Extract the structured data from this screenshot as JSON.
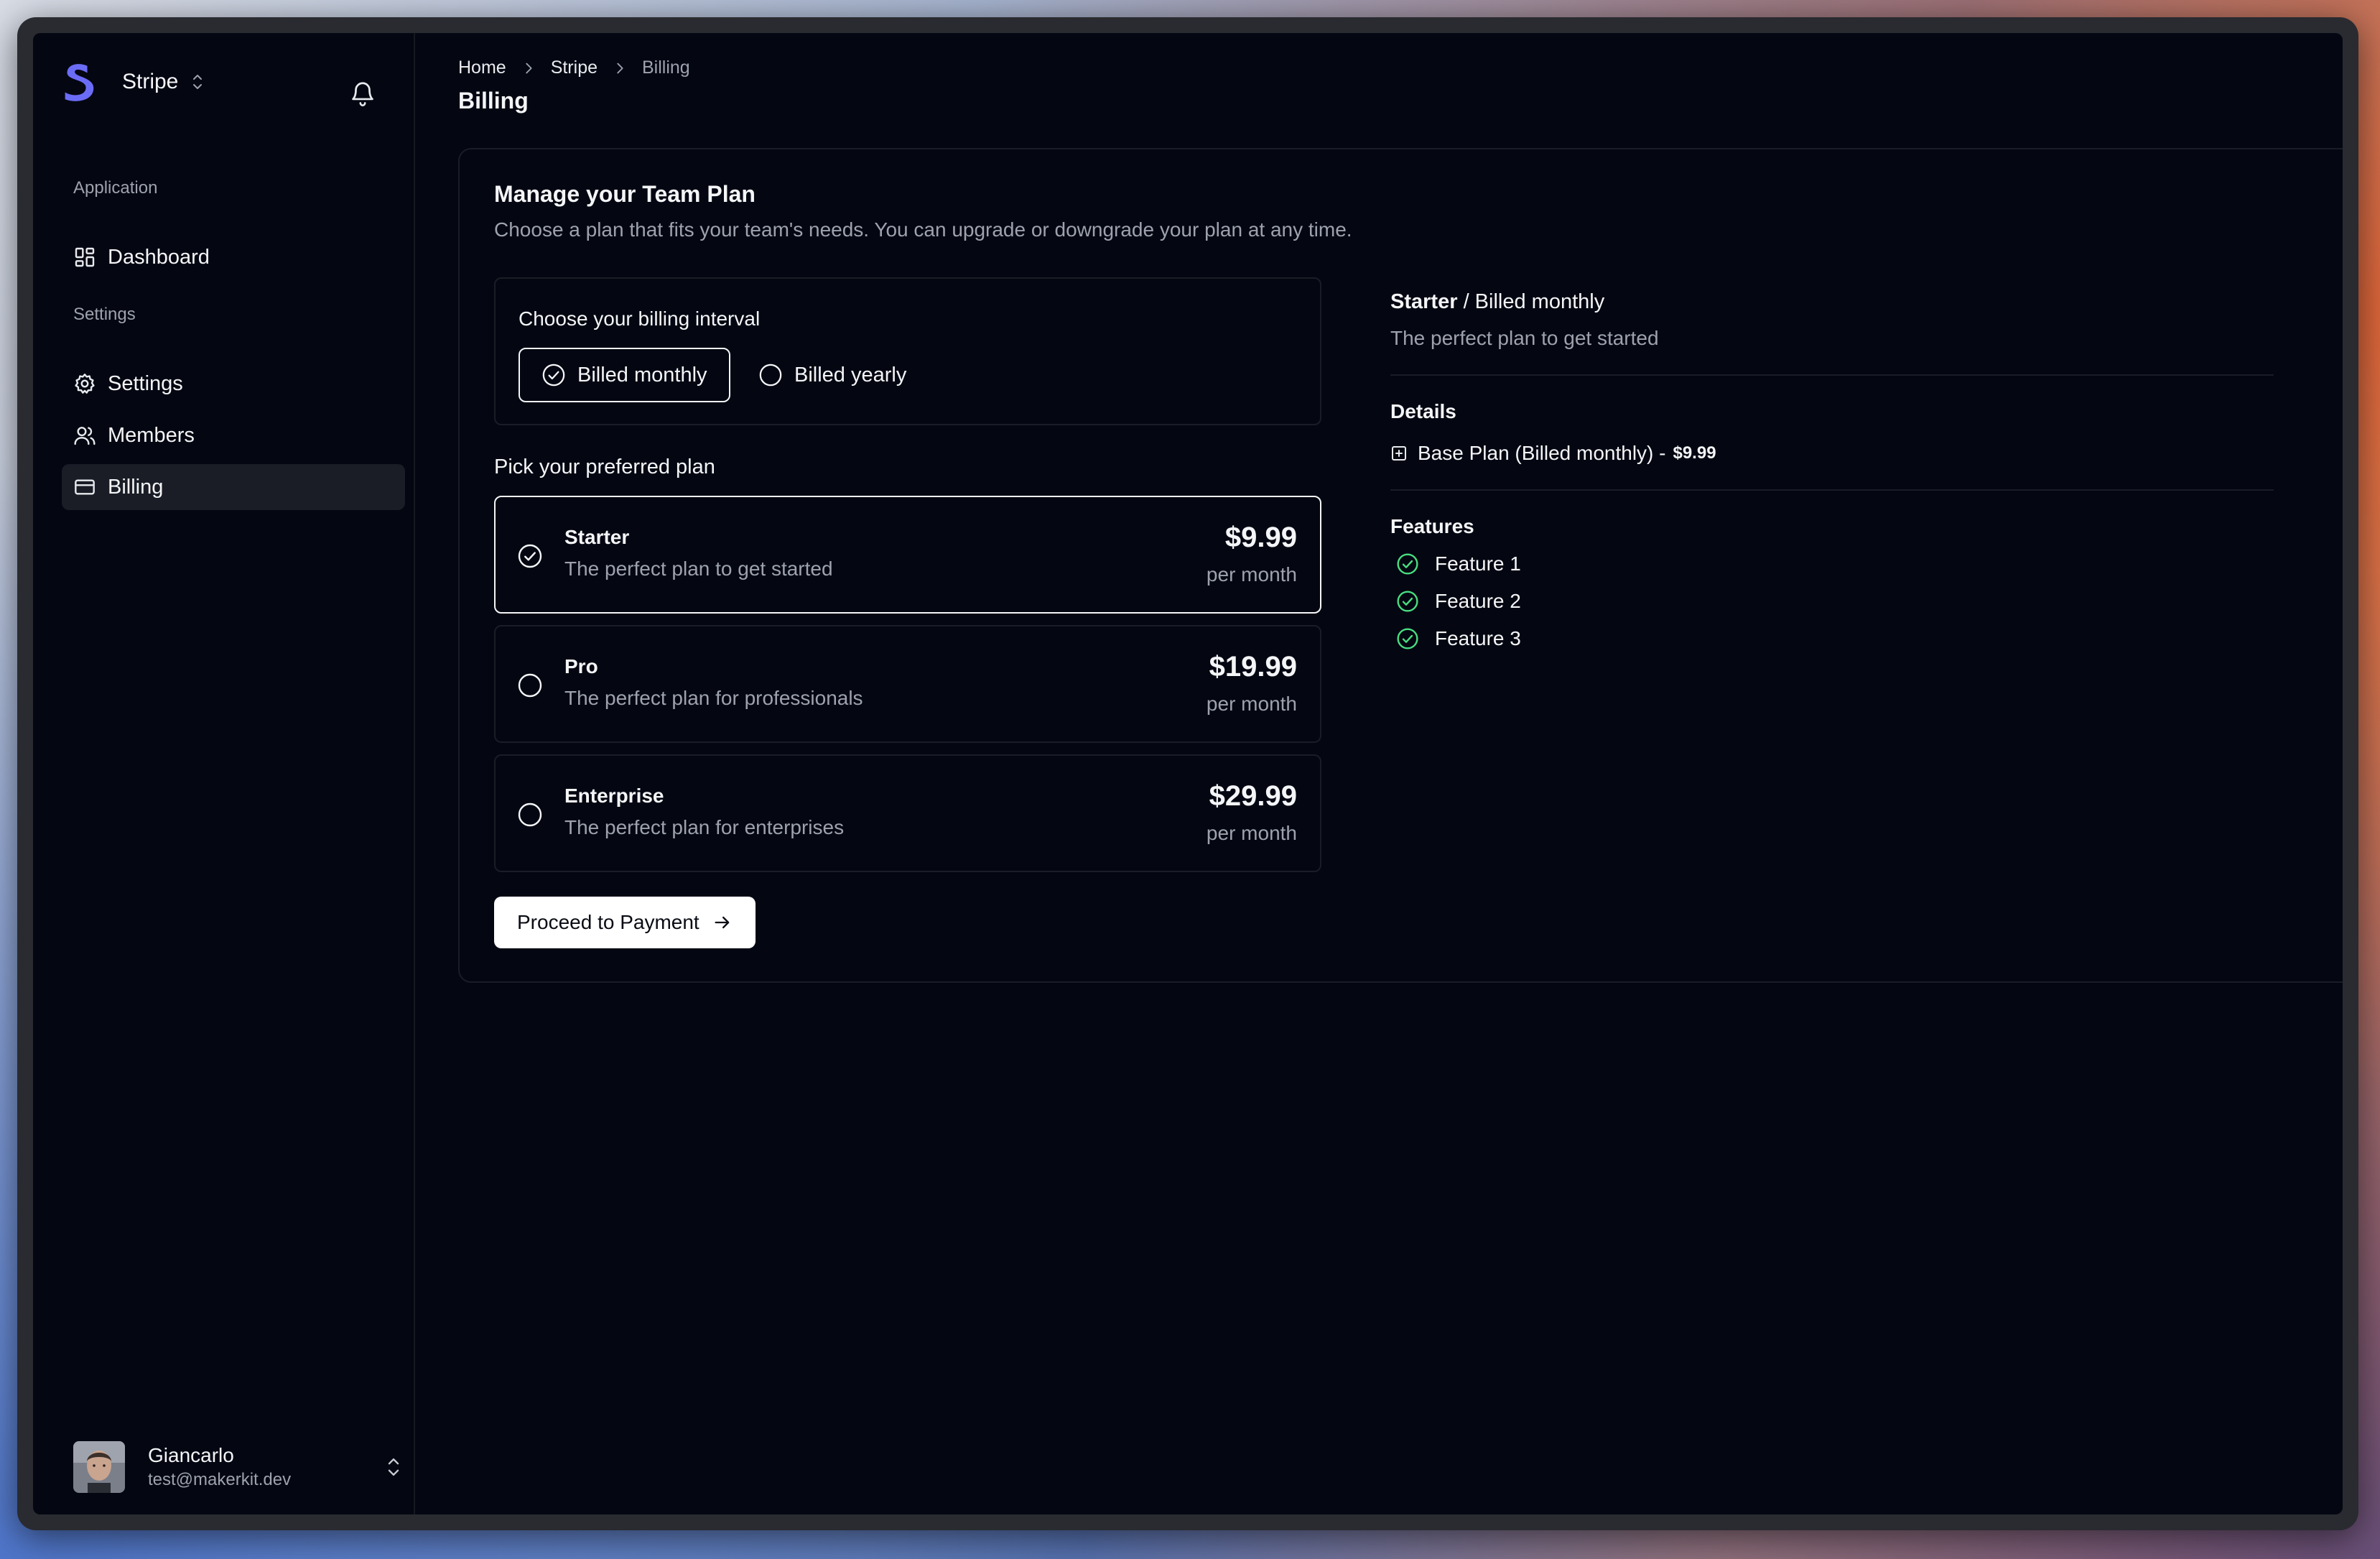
{
  "sidebar": {
    "org_name": "Stripe",
    "sections": [
      {
        "label": "Application",
        "items": [
          {
            "label": "Dashboard",
            "icon": "dashboard-icon"
          }
        ]
      },
      {
        "label": "Settings",
        "items": [
          {
            "label": "Settings",
            "icon": "gear-icon"
          },
          {
            "label": "Members",
            "icon": "users-icon"
          },
          {
            "label": "Billing",
            "icon": "credit-card-icon",
            "active": true
          }
        ]
      }
    ],
    "user": {
      "name": "Giancarlo",
      "email": "test@makerkit.dev"
    }
  },
  "breadcrumb": [
    "Home",
    "Stripe",
    "Billing"
  ],
  "page_title": "Billing",
  "plan_card": {
    "title": "Manage your Team Plan",
    "description": "Choose a plan that fits your team's needs. You can upgrade or downgrade your plan at any time.",
    "interval_label": "Choose your billing interval",
    "intervals": [
      {
        "label": "Billed monthly",
        "selected": true
      },
      {
        "label": "Billed yearly",
        "selected": false
      }
    ],
    "pick_label": "Pick your preferred plan",
    "plans": [
      {
        "name": "Starter",
        "description": "The perfect plan to get started",
        "price": "$9.99",
        "period": "per month",
        "selected": true
      },
      {
        "name": "Pro",
        "description": "The perfect plan for professionals",
        "price": "$19.99",
        "period": "per month",
        "selected": false
      },
      {
        "name": "Enterprise",
        "description": "The perfect plan for enterprises",
        "price": "$29.99",
        "period": "per month",
        "selected": false
      }
    ],
    "proceed_label": "Proceed to Payment"
  },
  "summary": {
    "plan_name": "Starter",
    "interval": "/ Billed monthly",
    "subtitle": "The perfect plan to get started",
    "details_heading": "Details",
    "detail_line": "Base Plan (Billed monthly) -",
    "detail_price": "$9.99",
    "features_heading": "Features",
    "features": [
      "Feature 1",
      "Feature 2",
      "Feature 3"
    ]
  },
  "colors": {
    "background": "#040712",
    "accent": "#6b6cf6",
    "feature_check": "#4ade80",
    "muted_text": "#9da2ae"
  }
}
